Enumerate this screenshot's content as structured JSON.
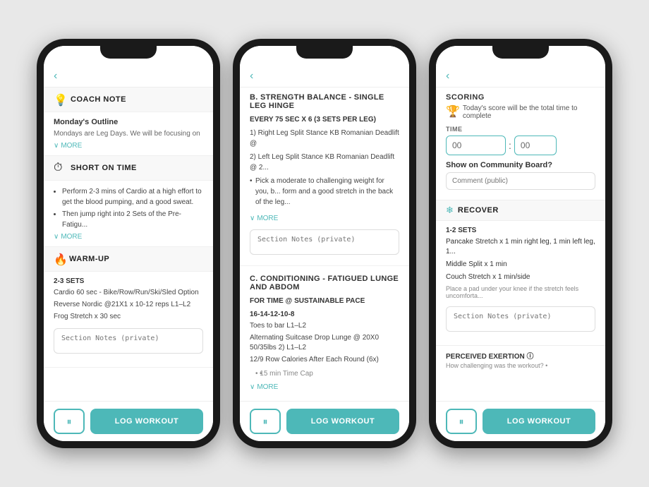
{
  "phones": [
    {
      "id": "phone1",
      "sections": [
        {
          "type": "coach-note",
          "icon": "💡",
          "title": "COACH NOTE",
          "subtitle": "Monday's Outline",
          "text": "Mondays are Leg Days. We will be focusing on",
          "has_more": true
        },
        {
          "type": "short-on-time",
          "icon": "⏱",
          "title": "SHORT ON TIME",
          "bullets": [
            "Perform 2-3 mins of Cardio at a high effort to get the blood pumping, and a good sweat.",
            "Then jump right into 2 Sets of the Pre-Fatigu..."
          ],
          "has_more": true
        },
        {
          "type": "warm-up",
          "icon": "🔥",
          "title": "WARM-UP",
          "sets": "2-3 SETS",
          "exercises": [
            "Cardio 60 sec - Bike/Row/Run/Ski/Sled Option",
            "Reverse Nordic @21X1 x 10-12 reps L1–L2",
            "Frog Stretch x 30 sec"
          ],
          "has_notes": true
        }
      ],
      "bottom": {
        "pause": "⏸",
        "log": "LOG WORKOUT"
      }
    },
    {
      "id": "phone2",
      "title": "B. STRENGTH BALANCE - SINGLE LEG HINGE",
      "every": "EVERY 75 SEC X 6 (3 SETS PER LEG)",
      "numbered": [
        "1) Right Leg Split Stance KB Romanian Deadlift @",
        "2) Left Leg Split Stance KB Romanian Deadlift @ 2..."
      ],
      "bullets": [
        "Pick a moderate to challenging weight for you, b... form and a good stretch in the back of the leg..."
      ],
      "has_more1": true,
      "section2": {
        "title": "C. CONDITIONING - FATIGUED LUNGE AND ABDOM",
        "subtitle": "FOR TIME @ SUSTAINABLE PACE",
        "rounds": "16-14-12-10-8",
        "items": [
          "Toes to bar L1–L2",
          "Alternating Suitcase Drop Lunge @ 20X0 50/35lbs 2) L1–L2",
          "12/9 Row Calories After Each Round (6x)"
        ],
        "timecap": "• 15 min Time Cap",
        "has_more": true
      },
      "bottom": {
        "pause": "⏸",
        "log": "LOG WORKOUT"
      }
    },
    {
      "id": "phone3",
      "scoring": {
        "title": "SCORING",
        "desc_icon": "🏆",
        "desc": "Today's score will be the total time to complete",
        "time_label": "TIME",
        "time_hours": "00",
        "time_mins": "00",
        "community_label": "Show on Community Board?",
        "comment_placeholder": "Comment (public)"
      },
      "recover": {
        "icon": "❄",
        "title": "RECOVER",
        "sets": "1-2 SETS",
        "items": [
          "Pancake Stretch x 1 min right leg, 1 min left leg, 1...",
          "Middle Split x 1 min",
          "Couch Stretch x 1 min/side"
        ],
        "note": "Place a pad under your knee if the stretch feels uncomforta..."
      },
      "perceived": {
        "title": "PERCEIVED EXERTION ⓘ",
        "subtitle": "How challenging was the workout? •"
      },
      "bottom": {
        "pause": "⏸",
        "log": "LOG WORKOUT"
      }
    }
  ]
}
